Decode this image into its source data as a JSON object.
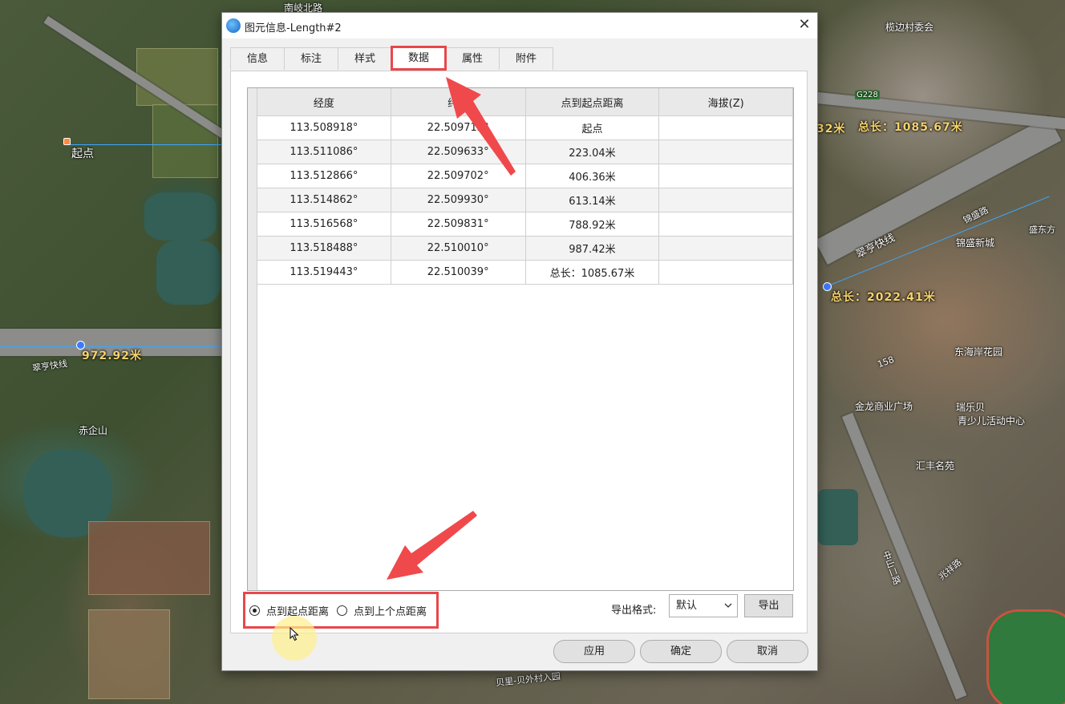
{
  "map": {
    "labels": {
      "start_point": "起点",
      "road_top": "南岐北路",
      "village_committee": "榄边村委会",
      "g228": "G228",
      "total_1": "总长：1085.67米",
      "total_2": "总长：2022.41米",
      "dist_972": "972.92米",
      "railway_left": "翠亨快线",
      "railway_right": "翠亨快线",
      "mountain": "赤企山",
      "jinsheng": "锦盛新城",
      "donghai": "东海岸花园",
      "jinlong": "金龙商业广场",
      "ruilebei": "瑞乐贝",
      "youth_center": "青少儿活动中心",
      "huifeng": "汇丰名苑",
      "beili": "贝里-贝外村入园",
      "jinsheng_road": "锦盛路",
      "zhaoxiang": "兆祥路",
      "zhongshan": "中山二路",
      "number_158": "158",
      "partial_32": "32米",
      "dongfang": "盛东方",
      "ludong": "中山"
    }
  },
  "dialog": {
    "title": "图元信息-Length#2",
    "close_glyph": "✕",
    "tabs": [
      "信息",
      "标注",
      "样式",
      "数据",
      "属性",
      "附件"
    ],
    "active_tab": "数据",
    "table": {
      "headers": [
        "经度",
        "纬度",
        "点到起点距离",
        "海拔(Z)"
      ],
      "rows": [
        [
          "113.508918°",
          "22.509712°",
          "起点",
          ""
        ],
        [
          "113.511086°",
          "22.509633°",
          "223.04米",
          ""
        ],
        [
          "113.512866°",
          "22.509702°",
          "406.36米",
          ""
        ],
        [
          "113.514862°",
          "22.509930°",
          "613.14米",
          ""
        ],
        [
          "113.516568°",
          "22.509831°",
          "788.92米",
          ""
        ],
        [
          "113.518488°",
          "22.510010°",
          "987.42米",
          ""
        ],
        [
          "113.519443°",
          "22.510039°",
          "总长：1085.67米",
          ""
        ]
      ]
    },
    "options": {
      "radio_start": "点到起点距离",
      "radio_prev": "点到上个点距离",
      "selected": "点到起点距离"
    },
    "export": {
      "label": "导出格式:",
      "format_value": "默认",
      "button": "导出"
    },
    "footer": {
      "apply": "应用",
      "ok": "确定",
      "cancel": "取消"
    }
  },
  "colors": {
    "highlight_red": "#e8474b",
    "arrow_red": "#f0494c",
    "map_label_yellow": "#f6d36a",
    "route_blue": "#3aa7ff"
  },
  "icons": {
    "app": "app-globe-icon",
    "close": "close-icon",
    "dropdown": "chevron-down-icon",
    "cursor": "mouse-cursor-icon"
  }
}
